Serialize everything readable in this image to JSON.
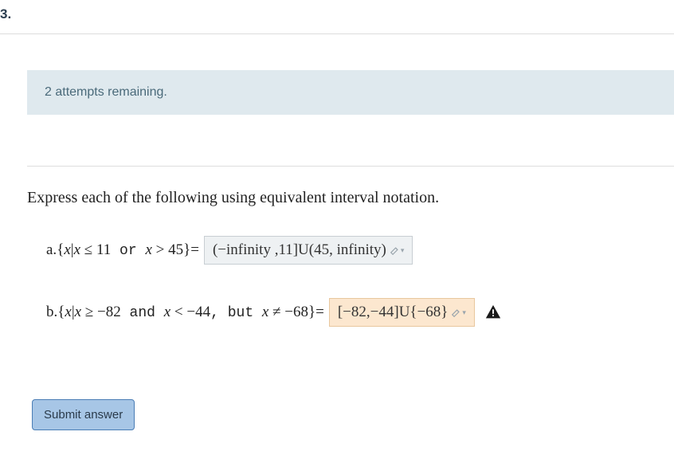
{
  "question_number": "3.",
  "attempts_text": "2 attempts remaining.",
  "prompt": "Express each of the following using equivalent interval notation.",
  "parts": {
    "a": {
      "label": "a. ",
      "set_open": "{",
      "var": "x",
      "bar": "|",
      "cond1_var": "x",
      "cond1_rel": " ≤ ",
      "cond1_val": "11",
      "connector": " or ",
      "cond2_var": "x",
      "cond2_rel": " > ",
      "cond2_val": "45",
      "set_close": "}",
      "equals": " = ",
      "answer": "(−infinity ,11]U(45, infinity)"
    },
    "b": {
      "label": "b. ",
      "set_open": "{",
      "var": "x",
      "bar": "|",
      "cond1_var": "x",
      "cond1_rel": " ≥ ",
      "cond1_val": "−82",
      "connector": " and ",
      "cond2_var": "x",
      "cond2_rel": " < ",
      "cond2_val": "−44",
      "but_text": ",  but ",
      "cond3_var": "x",
      "cond3_rel": " ≠ ",
      "cond3_val": "−68",
      "set_close": "}",
      "equals": " = ",
      "answer": "[−82,−44]U{−68}"
    }
  },
  "submit_label": "Submit answer"
}
